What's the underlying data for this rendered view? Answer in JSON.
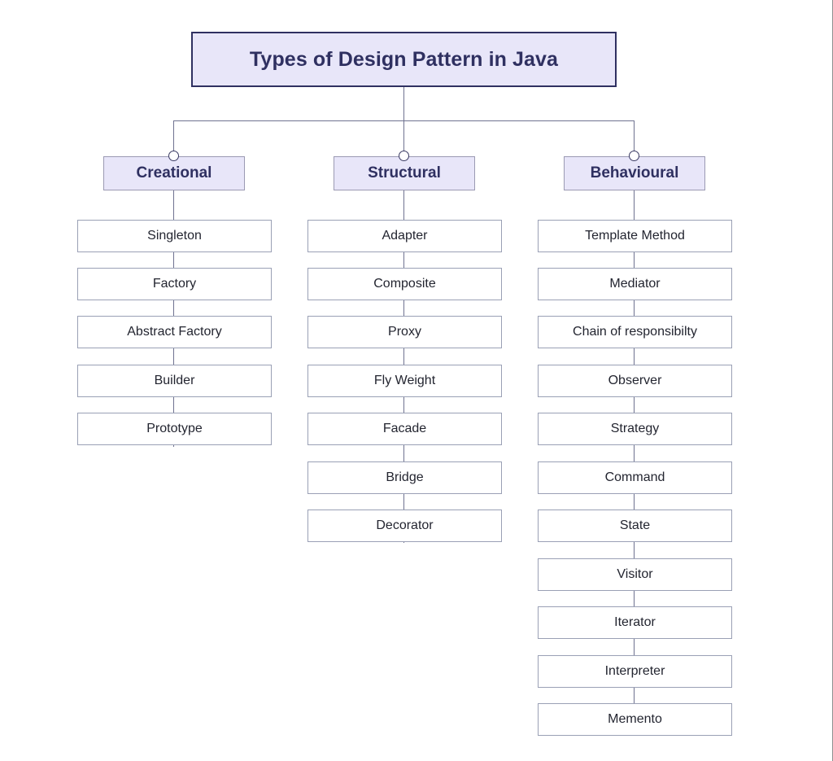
{
  "diagram": {
    "title": "Types of Design Pattern in Java",
    "colors": {
      "title_fill": "#e8e6f9",
      "title_border": "#2f3061",
      "title_text": "#2f3061",
      "category_fill": "#e8e6f9",
      "category_border": "#9b9ab3",
      "category_text": "#2f3061",
      "item_fill": "#ffffff",
      "item_border": "#9aa0b5",
      "item_text": "#232530",
      "connector": "#6f7290",
      "node_dot_stroke": "#3a3a63",
      "background": "#ffffff"
    },
    "columns": [
      {
        "category": "Creational",
        "items": [
          "Singleton",
          "Factory",
          "Abstract Factory",
          "Builder",
          "Prototype"
        ]
      },
      {
        "category": "Structural",
        "items": [
          "Adapter",
          "Composite",
          "Proxy",
          "Fly Weight",
          "Facade",
          "Bridge",
          "Decorator"
        ]
      },
      {
        "category": "Behavioural",
        "items": [
          "Template Method",
          "Mediator",
          "Chain of responsibilty",
          "Observer",
          "Strategy",
          "Command",
          "State",
          "Visitor",
          "Iterator",
          "Interpreter",
          "Memento"
        ]
      }
    ]
  }
}
